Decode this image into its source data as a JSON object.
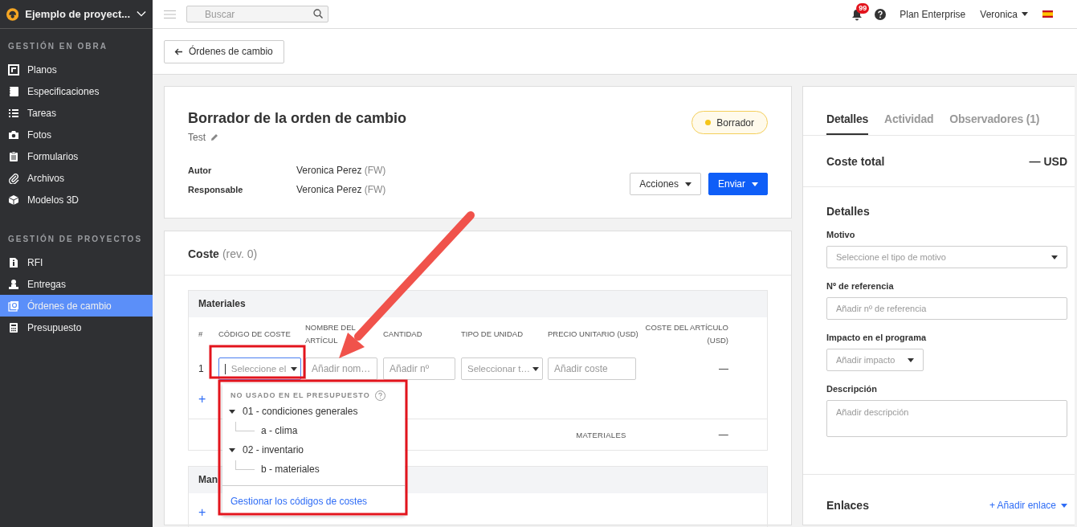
{
  "sidebar": {
    "project": "Ejemplo de proyect...",
    "sections": [
      {
        "title": "GESTIÓN EN OBRA",
        "items": [
          {
            "label": "Planos",
            "selected": false
          },
          {
            "label": "Especificaciones",
            "selected": false
          },
          {
            "label": "Tareas",
            "selected": false
          },
          {
            "label": "Fotos",
            "selected": false
          },
          {
            "label": "Formularios",
            "selected": false
          },
          {
            "label": "Archivos",
            "selected": false
          },
          {
            "label": "Modelos 3D",
            "selected": false
          }
        ]
      },
      {
        "title": "GESTIÓN DE PROYECTOS",
        "items": [
          {
            "label": "RFI",
            "selected": false
          },
          {
            "label": "Entregas",
            "selected": false
          },
          {
            "label": "Órdenes de cambio",
            "selected": true
          },
          {
            "label": "Presupuesto",
            "selected": false
          }
        ]
      }
    ]
  },
  "topbar": {
    "search": {
      "placeholder": "Buscar"
    },
    "notifications": "99",
    "plan": "Plan Enterprise",
    "user": "Veronica"
  },
  "back_button": "Órdenes de cambio",
  "change_order": {
    "title": "Borrador de la orden de cambio",
    "subtitle": "Test",
    "status": {
      "label": "Borrador",
      "color": "#f5c518"
    },
    "fields": [
      {
        "label": "Autor",
        "value": "Veronica Perez",
        "note": "(FW)"
      },
      {
        "label": "Responsable",
        "value": "Veronica Perez",
        "note": "(FW)"
      }
    ],
    "buttons": [
      {
        "label": "Acciones",
        "kind": "secondary"
      },
      {
        "label": "Enviar",
        "kind": "primary"
      }
    ]
  },
  "cost": {
    "title": "Coste",
    "revision": "(rev. 0)",
    "sections": [
      {
        "title": "Materiales",
        "columns": [
          "#",
          "CÓDIGO DE COSTE",
          "NOMBRE DEL ARTÍCUL",
          "CANTIDAD",
          "TIPO DE UNIDAD",
          "PRECIO UNITARIO (USD)",
          "COSTE DEL ARTÍCULO (USD)"
        ],
        "rows": [
          {
            "number": "1",
            "cost_code": {
              "placeholder": "Seleccione el",
              "focused": true
            },
            "item_name": {
              "placeholder": "Añadir nom…"
            },
            "quantity": {
              "placeholder": "Añadir nº"
            },
            "unit_type": {
              "placeholder": "Seleccionar t…"
            },
            "unit_price": {
              "placeholder": "Añadir coste"
            },
            "item_cost": "—"
          }
        ],
        "add": "+",
        "summary": {
          "label": "MATERIALES",
          "value": "—"
        }
      },
      {
        "title": "Man",
        "add": "+"
      }
    ],
    "cost_code_menu": {
      "heading": "NO USADO EN EL PRESUPUESTO",
      "groups": [
        {
          "label": "01 - condiciones generales",
          "expanded": true,
          "children": [
            {
              "label": "a - clima"
            }
          ]
        },
        {
          "label": "02 - inventario",
          "expanded": true,
          "children": [
            {
              "label": "b - materiales"
            }
          ]
        }
      ],
      "link": "Gestionar los códigos de costes"
    }
  },
  "details_panel": {
    "tabs": [
      {
        "label": "Detalles",
        "selected": true
      },
      {
        "label": "Actividad",
        "selected": false
      },
      {
        "label": "Observadores (1)",
        "selected": false
      }
    ],
    "total": {
      "label": "Coste total",
      "value": "— USD"
    },
    "section_title": "Detalles",
    "fields": [
      {
        "label": "Motivo",
        "kind": "select",
        "placeholder": "Seleccione el tipo de motivo"
      },
      {
        "label": "Nº de referencia",
        "kind": "input",
        "placeholder": "Añadir nº de referencia"
      },
      {
        "label": "Impacto en el programa",
        "kind": "compact_select",
        "placeholder": "Añadir impacto"
      },
      {
        "label": "Descripción",
        "kind": "textarea",
        "placeholder": "Añadir descripción"
      }
    ],
    "links": {
      "title": "Enlaces",
      "add": "+ Añadir enlace"
    }
  }
}
